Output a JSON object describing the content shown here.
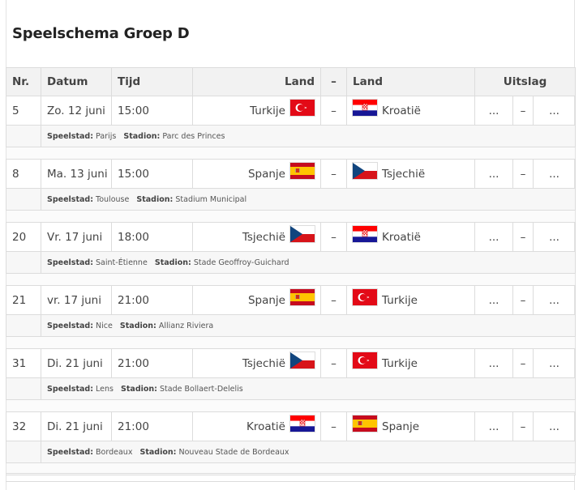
{
  "page": {
    "title": "Speelschema Groep D"
  },
  "headers": {
    "nr": "Nr.",
    "datum": "Datum",
    "tijd": "Tijd",
    "land_home": "Land",
    "dash": "–",
    "land_away": "Land",
    "uitslag": "Uitslag"
  },
  "labels": {
    "speelstad": "Speelstad:",
    "stadion": "Stadion:"
  },
  "flags": {
    "Turkije": "turkey-flag-icon",
    "Kroatië": "croatia-flag-icon",
    "Spanje": "spain-flag-icon",
    "Tsjechië": "czech-flag-icon"
  },
  "matches": [
    {
      "nr": "5",
      "datum": "Zo. 12 juni",
      "tijd": "15:00",
      "home": "Turkije",
      "dash": "–",
      "away": "Kroatië",
      "score_home": "...",
      "score_sep": "–",
      "score_away": "...",
      "speelstad": "Parijs",
      "stadion": "Parc des Princes"
    },
    {
      "nr": "8",
      "datum": "Ma. 13 juni",
      "tijd": "15:00",
      "home": "Spanje",
      "dash": "–",
      "away": "Tsjechië",
      "score_home": "...",
      "score_sep": "–",
      "score_away": "...",
      "speelstad": "Toulouse",
      "stadion": "Stadium Municipal"
    },
    {
      "nr": "20",
      "datum": "Vr. 17 juni",
      "tijd": "18:00",
      "home": "Tsjechië",
      "dash": "–",
      "away": "Kroatië",
      "score_home": "...",
      "score_sep": "–",
      "score_away": "...",
      "speelstad": "Saint-Étienne",
      "stadion": "Stade Geoffroy-Guichard"
    },
    {
      "nr": "21",
      "datum": "vr. 17 juni",
      "tijd": "21:00",
      "home": "Spanje",
      "dash": "–",
      "away": "Turkije",
      "score_home": "...",
      "score_sep": "–",
      "score_away": "...",
      "speelstad": "Nice",
      "stadion": "Allianz Riviera"
    },
    {
      "nr": "31",
      "datum": "Di. 21 juni",
      "tijd": "21:00",
      "home": "Tsjechië",
      "dash": "–",
      "away": "Turkije",
      "score_home": "...",
      "score_sep": "–",
      "score_away": "...",
      "speelstad": "Lens",
      "stadion": "Stade Bollaert-Delelis"
    },
    {
      "nr": "32",
      "datum": "Di. 21 juni",
      "tijd": "21:00",
      "home": "Kroatië",
      "dash": "–",
      "away": "Spanje",
      "score_home": "...",
      "score_sep": "–",
      "score_away": "...",
      "speelstad": "Bordeaux",
      "stadion": "Nouveau Stade de Bordeaux"
    }
  ]
}
